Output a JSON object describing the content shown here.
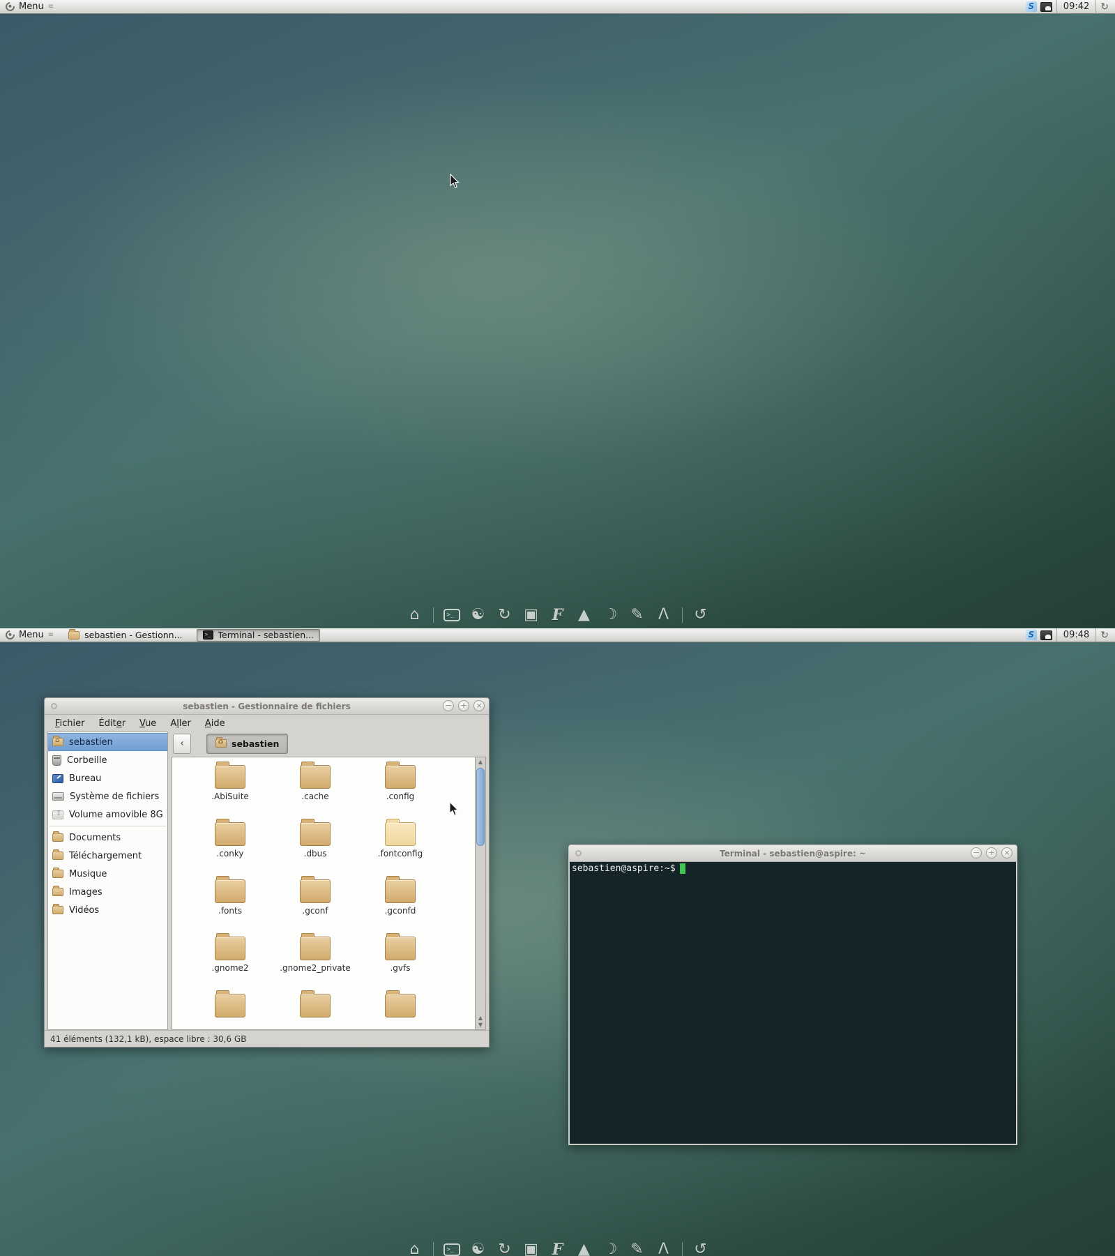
{
  "colors": {
    "panel_bg": "#e3e3e0",
    "desktop_teal": "#47706e",
    "accent_blue": "#7ea6d4",
    "folder_tan": "#d3ab6e",
    "terminal_bg": "#152428",
    "terminal_green": "#3ec94e"
  },
  "panel1": {
    "menu_label": "Menu",
    "menu_grip": "≡",
    "clock": "09:42",
    "session_glyph": "↻",
    "tray_swirl_glyph": "S"
  },
  "panel2": {
    "menu_label": "Menu",
    "menu_grip": "≡",
    "clock": "09:48",
    "session_glyph": "↻",
    "tray_swirl_glyph": "S",
    "tasks": [
      {
        "label": "sebastien - Gestionn...",
        "icon": "folder",
        "active": false
      },
      {
        "label": "Terminal - sebastien...",
        "icon": "terminal",
        "term_glyph": ">_",
        "active": true
      }
    ]
  },
  "dock": {
    "items": [
      {
        "name": "home",
        "glyph": "⌂"
      },
      {
        "name": "terminal",
        "glyph": ">_"
      },
      {
        "name": "web-browser",
        "glyph": "☯"
      },
      {
        "name": "refresh",
        "glyph": "↻"
      },
      {
        "name": "image-viewer",
        "glyph": "▣"
      },
      {
        "name": "f-application",
        "glyph": "F"
      },
      {
        "name": "cone-player",
        "glyph": "▲"
      },
      {
        "name": "bird-app",
        "glyph": "☽"
      },
      {
        "name": "pen-tool",
        "glyph": "✎"
      },
      {
        "name": "media-player",
        "glyph": "Λ"
      },
      {
        "name": "software-update",
        "glyph": "↺"
      }
    ]
  },
  "window_controls": {
    "minimize": "−",
    "maximize": "+",
    "close": "×"
  },
  "filemanager": {
    "title": "sebastien - Gestionnaire de fichiers",
    "menu": [
      {
        "label": "Fichier",
        "m": 0
      },
      {
        "label": "Éditer",
        "m": 4
      },
      {
        "label": "Vue",
        "m": 0
      },
      {
        "label": "Aller",
        "m": 1
      },
      {
        "label": "Aide",
        "m": 0
      }
    ],
    "toolbar": {
      "back_glyph": "‹",
      "path_button": "sebastien"
    },
    "sidebar": [
      {
        "label": "sebastien",
        "icon": "home",
        "selected": true
      },
      {
        "label": "Corbeille",
        "icon": "trash"
      },
      {
        "label": "Bureau",
        "icon": "desktop"
      },
      {
        "label": "Système de fichiers",
        "icon": "drive"
      },
      {
        "label": "Volume amovible 8G",
        "icon": "removable"
      },
      {
        "label": "Documents",
        "icon": "folder"
      },
      {
        "label": "Téléchargement",
        "icon": "folder"
      },
      {
        "label": "Musique",
        "icon": "folder"
      },
      {
        "label": "Images",
        "icon": "folder"
      },
      {
        "label": "Vidéos",
        "icon": "folder"
      }
    ],
    "folders": [
      ".AbiSuite",
      ".cache",
      ".config",
      ".conky",
      ".dbus",
      ".fontconfig",
      ".fonts",
      ".gconf",
      ".gconfd",
      ".gnome2",
      ".gnome2_private",
      ".gvfs"
    ],
    "partial_row_count": 3,
    "statusbar": "41 éléments (132,1 kB), espace libre : 30,6 GB"
  },
  "terminal": {
    "title": "Terminal - sebastien@aspire: ~",
    "prompt": "sebastien@aspire:~$"
  }
}
